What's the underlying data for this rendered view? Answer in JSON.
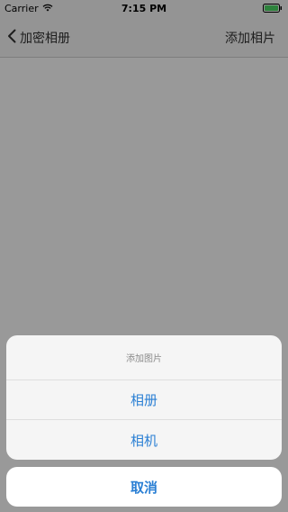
{
  "status_bar": {
    "carrier": "Carrier",
    "time": "7:15 PM",
    "wifi_icon": "wifi-icon",
    "battery_icon": "battery-icon",
    "battery_color": "#4cd964"
  },
  "nav_bar": {
    "back_label": "加密相册",
    "right_label": "添加相片",
    "back_icon": "chevron-left-icon"
  },
  "action_sheet": {
    "title": "添加图片",
    "actions": [
      {
        "label": "相册"
      },
      {
        "label": "相机"
      }
    ],
    "cancel_label": "取消",
    "accent_color": "#2a7fd4"
  }
}
